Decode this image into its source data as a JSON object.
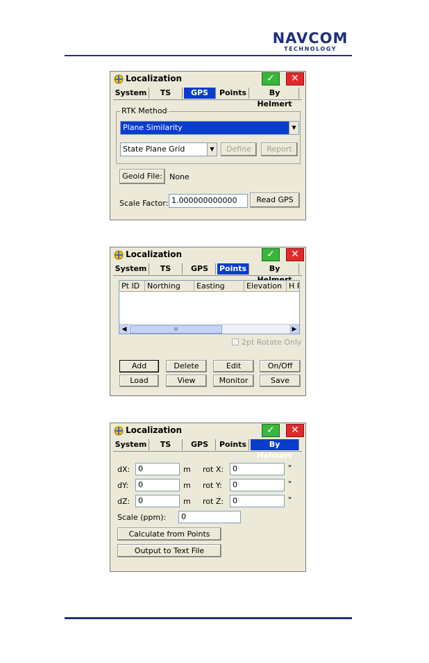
{
  "logo": {
    "line1": "NAVCOM",
    "line2": "TECHNOLOGY"
  },
  "colors": {
    "brand": "#1f2f7a",
    "tab_selected": "#0a3dcc",
    "ok": "#3bb53b",
    "close": "#e02a2a"
  },
  "window_title": "Localization",
  "ok_glyph": "✓",
  "close_glyph": "✕",
  "tabs": [
    "System",
    "TS",
    "GPS",
    "Points",
    "By Helmert"
  ],
  "gps": {
    "selected_tab": "GPS",
    "rtk_method_label": "RTK Method",
    "rtk_method_value": "Plane Similarity",
    "grid_value": "State Plane Grid",
    "define_label": "Define",
    "report_label": "Report",
    "geoid_button": "Geoid File:",
    "geoid_value": "None",
    "scale_factor_label": "Scale Factor:",
    "scale_factor_value": "1.000000000000",
    "read_gps_label": "Read GPS"
  },
  "points": {
    "selected_tab": "Points",
    "columns": [
      "Pt ID",
      "Northing",
      "Easting",
      "Elevation",
      "H R"
    ],
    "scrollbar_grip": "III",
    "two_pt_rotate": "2pt Rotate Only",
    "buttons_row1": [
      "Add",
      "Delete",
      "Edit",
      "On/Off"
    ],
    "buttons_row2": [
      "Load",
      "View",
      "Monitor",
      "Save"
    ]
  },
  "helmert": {
    "selected_tab": "By Helmert",
    "dx_label": "dX:",
    "dx_value": "0",
    "dy_label": "dY:",
    "dy_value": "0",
    "dz_label": "dZ:",
    "dz_value": "0",
    "unit_m": "m",
    "rotx_label": "rot X:",
    "rotx_value": "0",
    "roty_label": "rot Y:",
    "roty_value": "0",
    "rotz_label": "rot Z:",
    "rotz_value": "0",
    "unit_sec": "\"",
    "scale_label": "Scale (ppm):",
    "scale_value": "0",
    "calc_button": "Calculate from Points",
    "output_button": "Output to Text File"
  }
}
